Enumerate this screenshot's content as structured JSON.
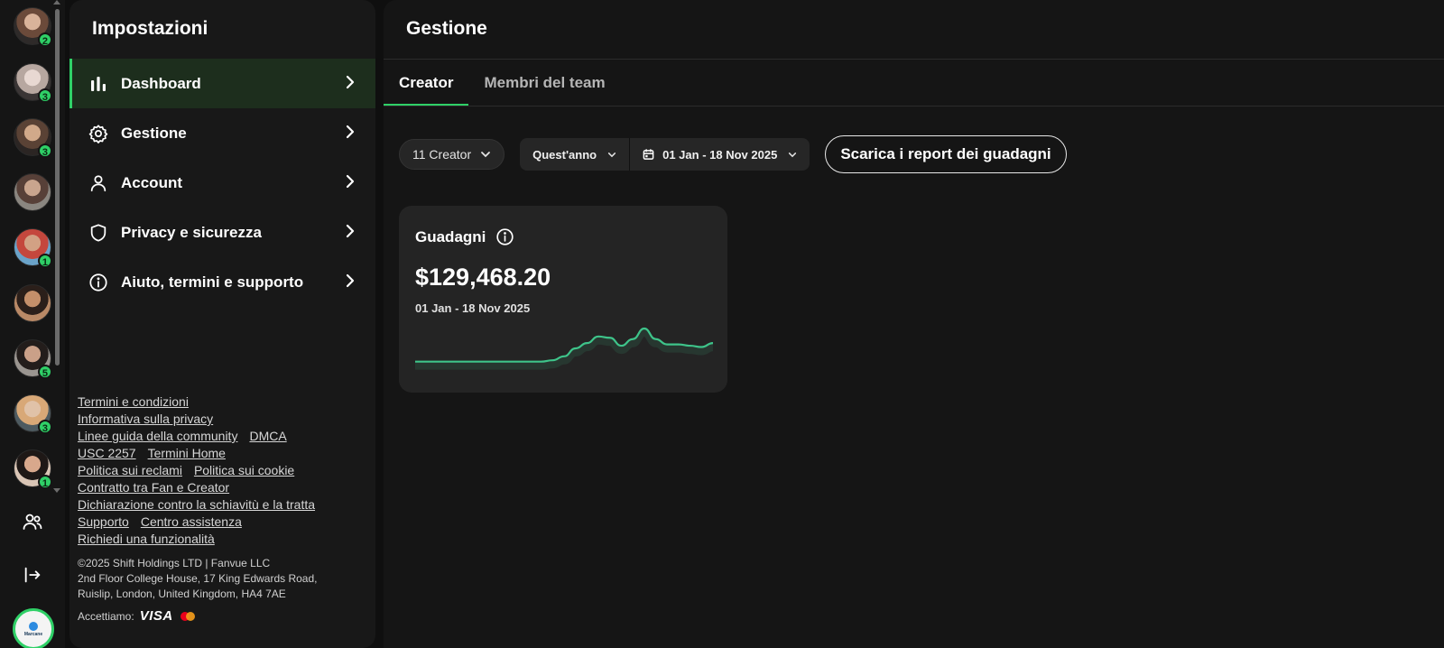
{
  "rail": {
    "avatars": [
      {
        "badge": "2"
      },
      {
        "badge": "3"
      },
      {
        "badge": "3"
      },
      {
        "badge": ""
      },
      {
        "badge": "1"
      },
      {
        "badge": ""
      },
      {
        "badge": "5"
      },
      {
        "badge": "3"
      },
      {
        "badge": "1"
      }
    ],
    "team_icon": "users-icon",
    "logout_icon": "logout-icon",
    "logo_text": "Marcane"
  },
  "settings": {
    "title": "Impostazioni",
    "menu": [
      {
        "label": "Dashboard",
        "icon": "bar-chart-icon",
        "active": true
      },
      {
        "label": "Gestione",
        "icon": "gear-icon",
        "active": false
      },
      {
        "label": "Account",
        "icon": "user-icon",
        "active": false
      },
      {
        "label": "Privacy e sicurezza",
        "icon": "shield-icon",
        "active": false
      },
      {
        "label": "Aiuto, termini e supporto",
        "icon": "info-icon",
        "active": false
      }
    ],
    "footer_links": {
      "terms": "Termini e condizioni",
      "privacy": "Informativa sulla privacy",
      "community": "Linee guida della community",
      "dmca": "DMCA",
      "usc": "USC 2257",
      "terms_home": "Termini Home",
      "complaints": "Politica sui reclami",
      "cookies": "Politica sui cookie",
      "contract": "Contratto tra Fan e Creator",
      "slavery": "Dichiarazione contro la schiavitù e la tratta",
      "support": "Supporto",
      "help_center": "Centro assistenza",
      "feature": "Richiedi una funzionalità"
    },
    "copyright": {
      "line1": "©2025 Shift Holdings LTD | Fanvue LLC",
      "line2": "2nd Floor College House, 17 King Edwards Road,",
      "line3": "Ruislip, London, United Kingdom, HA4 7AE"
    },
    "accept_label": "Accettiamo:",
    "visa_label": "VISA",
    "mastercard_colors": [
      "#eb001b",
      "#f79e1b"
    ]
  },
  "main": {
    "title": "Gestione",
    "tabs": [
      {
        "label": "Creator",
        "active": true
      },
      {
        "label": "Membri del team",
        "active": false
      }
    ],
    "filters": {
      "creator_count": "11 Creator",
      "period": "Quest'anno",
      "date_range": "01 Jan - 18 Nov 2025",
      "download_label": "Scarica i report dei guadagni"
    },
    "card": {
      "title": "Guadagni",
      "amount": "$129,468.20",
      "range": "01 Jan - 18 Nov 2025",
      "sparkline_color": "#3ec48a",
      "sparkline_values": [
        5,
        5,
        5,
        5,
        5,
        5,
        5,
        5,
        5,
        5,
        5,
        5,
        6,
        9,
        15,
        19,
        24,
        23,
        17,
        22,
        30,
        22,
        18,
        18,
        17,
        16,
        19
      ]
    }
  },
  "colors": {
    "accent": "#2fd067",
    "panel": "#181818",
    "card": "#242424"
  }
}
